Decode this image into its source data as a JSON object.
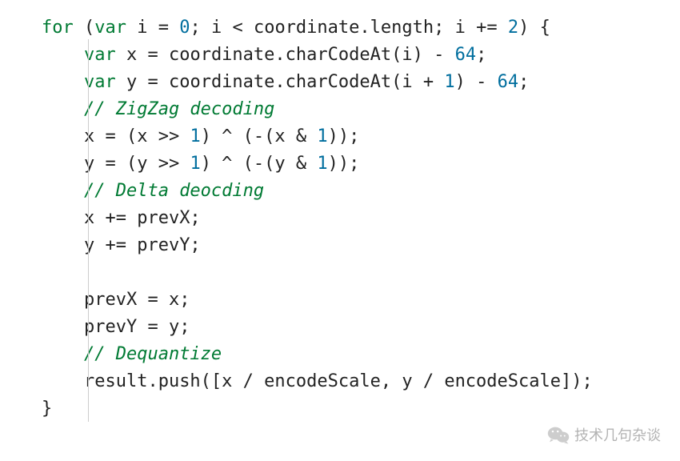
{
  "code": {
    "lines": [
      {
        "indent": 0,
        "tokens": [
          {
            "t": "kw",
            "s": "for"
          },
          {
            "t": "",
            "s": " ("
          },
          {
            "t": "kw",
            "s": "var"
          },
          {
            "t": "",
            "s": " i = "
          },
          {
            "t": "num",
            "s": "0"
          },
          {
            "t": "",
            "s": "; i < coordinate.length; i += "
          },
          {
            "t": "num",
            "s": "2"
          },
          {
            "t": "",
            "s": ") {"
          }
        ]
      },
      {
        "indent": 1,
        "tokens": [
          {
            "t": "kw",
            "s": "var"
          },
          {
            "t": "",
            "s": " x = coordinate.charCodeAt(i) - "
          },
          {
            "t": "num",
            "s": "64"
          },
          {
            "t": "",
            "s": ";"
          }
        ]
      },
      {
        "indent": 1,
        "tokens": [
          {
            "t": "kw",
            "s": "var"
          },
          {
            "t": "",
            "s": " y = coordinate.charCodeAt(i + "
          },
          {
            "t": "num",
            "s": "1"
          },
          {
            "t": "",
            "s": ") - "
          },
          {
            "t": "num",
            "s": "64"
          },
          {
            "t": "",
            "s": ";"
          }
        ]
      },
      {
        "indent": 1,
        "tokens": [
          {
            "t": "cmt",
            "s": "// ZigZag decoding"
          }
        ]
      },
      {
        "indent": 1,
        "tokens": [
          {
            "t": "",
            "s": "x = (x >> "
          },
          {
            "t": "num",
            "s": "1"
          },
          {
            "t": "",
            "s": ") ^ (-(x & "
          },
          {
            "t": "num",
            "s": "1"
          },
          {
            "t": "",
            "s": "));"
          }
        ]
      },
      {
        "indent": 1,
        "tokens": [
          {
            "t": "",
            "s": "y = (y >> "
          },
          {
            "t": "num",
            "s": "1"
          },
          {
            "t": "",
            "s": ") ^ (-(y & "
          },
          {
            "t": "num",
            "s": "1"
          },
          {
            "t": "",
            "s": "));"
          }
        ]
      },
      {
        "indent": 1,
        "tokens": [
          {
            "t": "cmt",
            "s": "// Delta deocding"
          }
        ]
      },
      {
        "indent": 1,
        "tokens": [
          {
            "t": "",
            "s": "x += prevX;"
          }
        ]
      },
      {
        "indent": 1,
        "tokens": [
          {
            "t": "",
            "s": "y += prevY;"
          }
        ]
      },
      {
        "indent": 1,
        "tokens": [
          {
            "t": "",
            "s": ""
          }
        ]
      },
      {
        "indent": 1,
        "tokens": [
          {
            "t": "",
            "s": "prevX = x;"
          }
        ]
      },
      {
        "indent": 1,
        "tokens": [
          {
            "t": "",
            "s": "prevY = y;"
          }
        ]
      },
      {
        "indent": 1,
        "tokens": [
          {
            "t": "cmt",
            "s": "// Dequantize"
          }
        ]
      },
      {
        "indent": 1,
        "tokens": [
          {
            "t": "",
            "s": "result.push([x / encodeScale, y / encodeScale]);"
          }
        ]
      },
      {
        "indent": 0,
        "tokens": [
          {
            "t": "",
            "s": "}"
          }
        ]
      }
    ],
    "indent_unit": "    "
  },
  "watermark": {
    "text": "技术几句杂谈",
    "icon": "wechat-icon"
  }
}
